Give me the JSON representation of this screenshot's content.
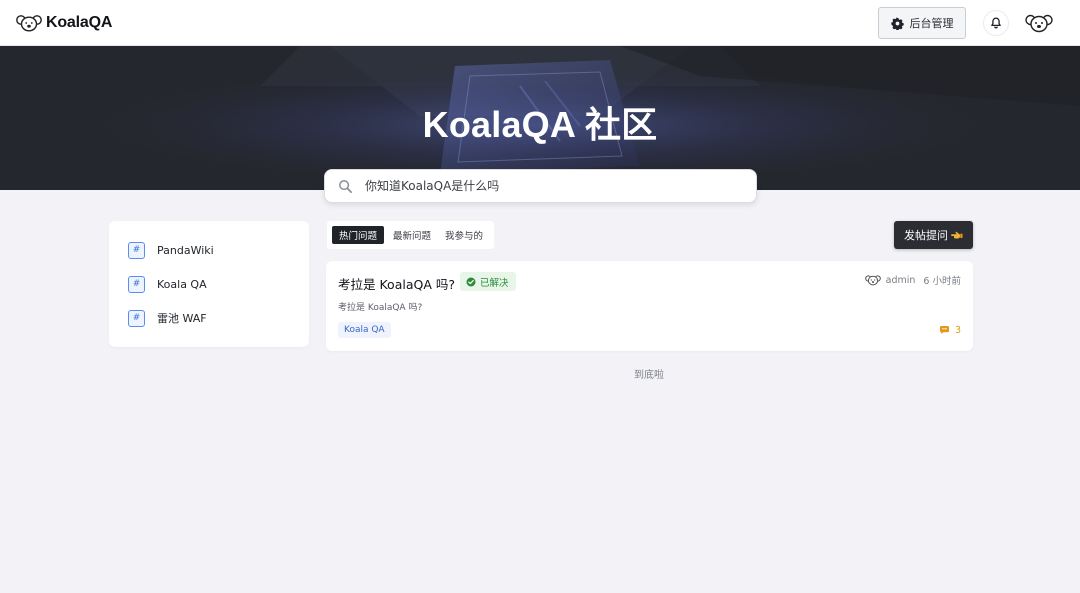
{
  "header": {
    "brand_name": "KoalaQA",
    "admin_button": "后台管理",
    "icons": {
      "logo": "koala-logo-icon",
      "admin": "gear-icon",
      "notifications": "bell-icon",
      "avatar": "koala-avatar-icon"
    }
  },
  "hero": {
    "title": "KoalaQA 社区"
  },
  "search": {
    "placeholder": "你知道KoalaQA是什么吗",
    "value": "",
    "icon": "search-icon"
  },
  "sidebar": {
    "items": [
      {
        "label": "PandaWiki",
        "icon": "hash-icon"
      },
      {
        "label": "Koala QA",
        "icon": "hash-icon"
      },
      {
        "label": "雷池 WAF",
        "icon": "hash-icon"
      }
    ]
  },
  "tabs": [
    {
      "label": "热门问题",
      "active": true
    },
    {
      "label": "最新问题",
      "active": false
    },
    {
      "label": "我参与的",
      "active": false
    }
  ],
  "post_button": {
    "label": "发帖提问",
    "icon": "pointing-hand-icon"
  },
  "questions": [
    {
      "title": "考拉是 KoalaQA 吗?",
      "status": "已解决",
      "author": "admin",
      "time": "6 小时前",
      "excerpt": "考拉是 KoalaQA 吗?",
      "tag": "Koala QA",
      "comments": "3"
    }
  ],
  "list_end": "到底啦",
  "colors": {
    "accent": "#20232a",
    "solved_green": "#2e8b3a",
    "tag_blue": "#3a66c9",
    "comment_orange": "#e39a1a",
    "page_bg": "#f3f3f7",
    "hero_bg": "#24262d"
  }
}
